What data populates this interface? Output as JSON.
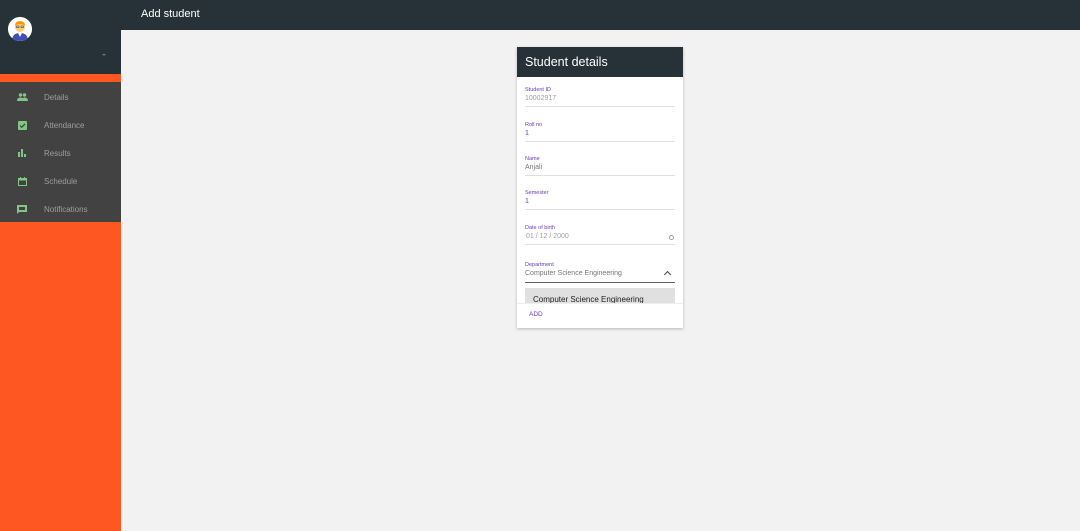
{
  "topbar": {
    "title": "Add student"
  },
  "sidebar": {
    "items": [
      {
        "label": "Details",
        "icon": "people-icon"
      },
      {
        "label": "Attendance",
        "icon": "check-box-icon"
      },
      {
        "label": "Results",
        "icon": "bar-chart-icon"
      },
      {
        "label": "Schedule",
        "icon": "calendar-icon"
      },
      {
        "label": "Notifications",
        "icon": "message-icon"
      }
    ]
  },
  "card": {
    "title": "Student details",
    "fields": {
      "student_id": {
        "label": "Student ID",
        "value": "10002917"
      },
      "roll_no": {
        "label": "Roll no",
        "value": "1"
      },
      "name": {
        "label": "Name",
        "value": "Anjali"
      },
      "semester": {
        "label": "Semester",
        "value": "1"
      },
      "dob": {
        "label": "Date of birth",
        "value": "01 / 12 / 2000"
      },
      "department": {
        "label": "Department",
        "value": "Computer Science Engineering"
      }
    },
    "dropdown_option": "Computer Science Engineering",
    "add_label": "ADD"
  },
  "colors": {
    "sidebar": "#ff5722",
    "dark": "#263238",
    "nav_bg": "#424242",
    "icon_green": "#81c784",
    "accent": "#673ab7"
  }
}
